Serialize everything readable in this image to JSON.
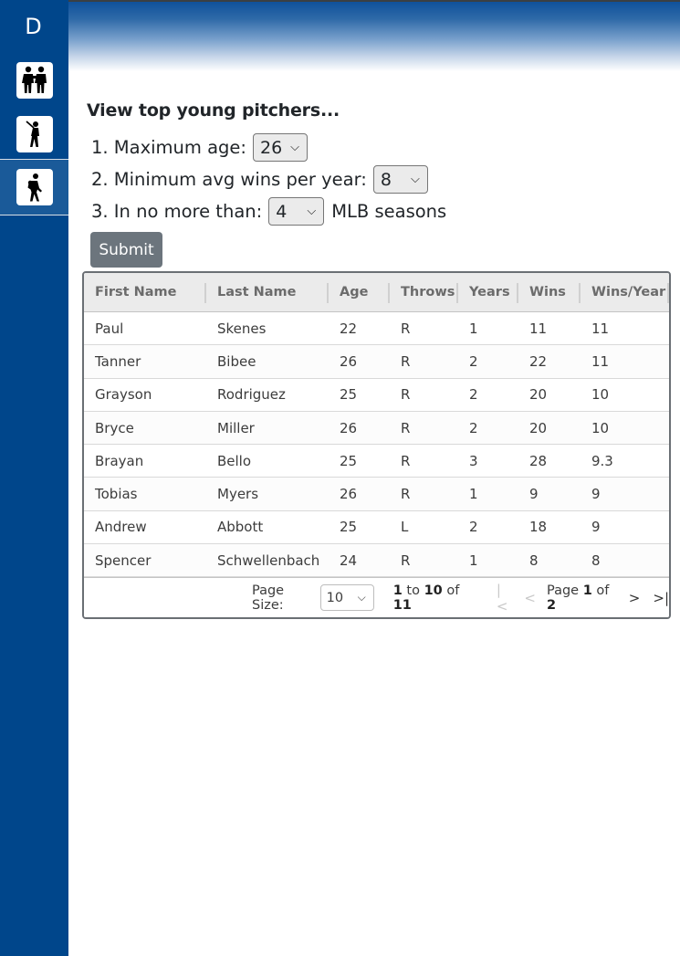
{
  "sidebar": {
    "brand": "D",
    "items": [
      {
        "icon": "two-players-icon"
      },
      {
        "icon": "batter-icon"
      },
      {
        "icon": "pitcher-icon",
        "active": true
      }
    ]
  },
  "form": {
    "title": "View top young pitchers...",
    "q1_label": "1. Maximum age:",
    "q1_value": "26",
    "q2_label": "2. Minimum avg wins per year:",
    "q2_value": "8",
    "q3_label": "3. In no more than:",
    "q3_value": "4",
    "q3_suffix": "MLB seasons",
    "submit_label": "Submit"
  },
  "table": {
    "columns": [
      "First Name",
      "Last Name",
      "Age",
      "Throws",
      "Years",
      "Wins",
      "Wins/Year"
    ],
    "rows": [
      [
        "Paul",
        "Skenes",
        "22",
        "R",
        "1",
        "11",
        "11"
      ],
      [
        "Tanner",
        "Bibee",
        "26",
        "R",
        "2",
        "22",
        "11"
      ],
      [
        "Grayson",
        "Rodriguez",
        "25",
        "R",
        "2",
        "20",
        "10"
      ],
      [
        "Bryce",
        "Miller",
        "26",
        "R",
        "2",
        "20",
        "10"
      ],
      [
        "Brayan",
        "Bello",
        "25",
        "R",
        "3",
        "28",
        "9.3"
      ],
      [
        "Tobias",
        "Myers",
        "26",
        "R",
        "1",
        "9",
        "9"
      ],
      [
        "Andrew",
        "Abbott",
        "25",
        "L",
        "2",
        "18",
        "9"
      ],
      [
        "Spencer",
        "Schwellenbach",
        "24",
        "R",
        "1",
        "8",
        "8"
      ]
    ],
    "footer": {
      "page_size_label": "Page Size:",
      "page_size_value": "10",
      "range_from": "1",
      "range_to_word": "to",
      "range_to": "10",
      "range_of_word": "of",
      "range_total": "11",
      "page_word": "Page",
      "page_current": "1",
      "page_of_word": "of",
      "page_total": "2",
      "first_page": "|<",
      "prev_page": "<",
      "next_page": ">",
      "last_page": ">|"
    }
  }
}
